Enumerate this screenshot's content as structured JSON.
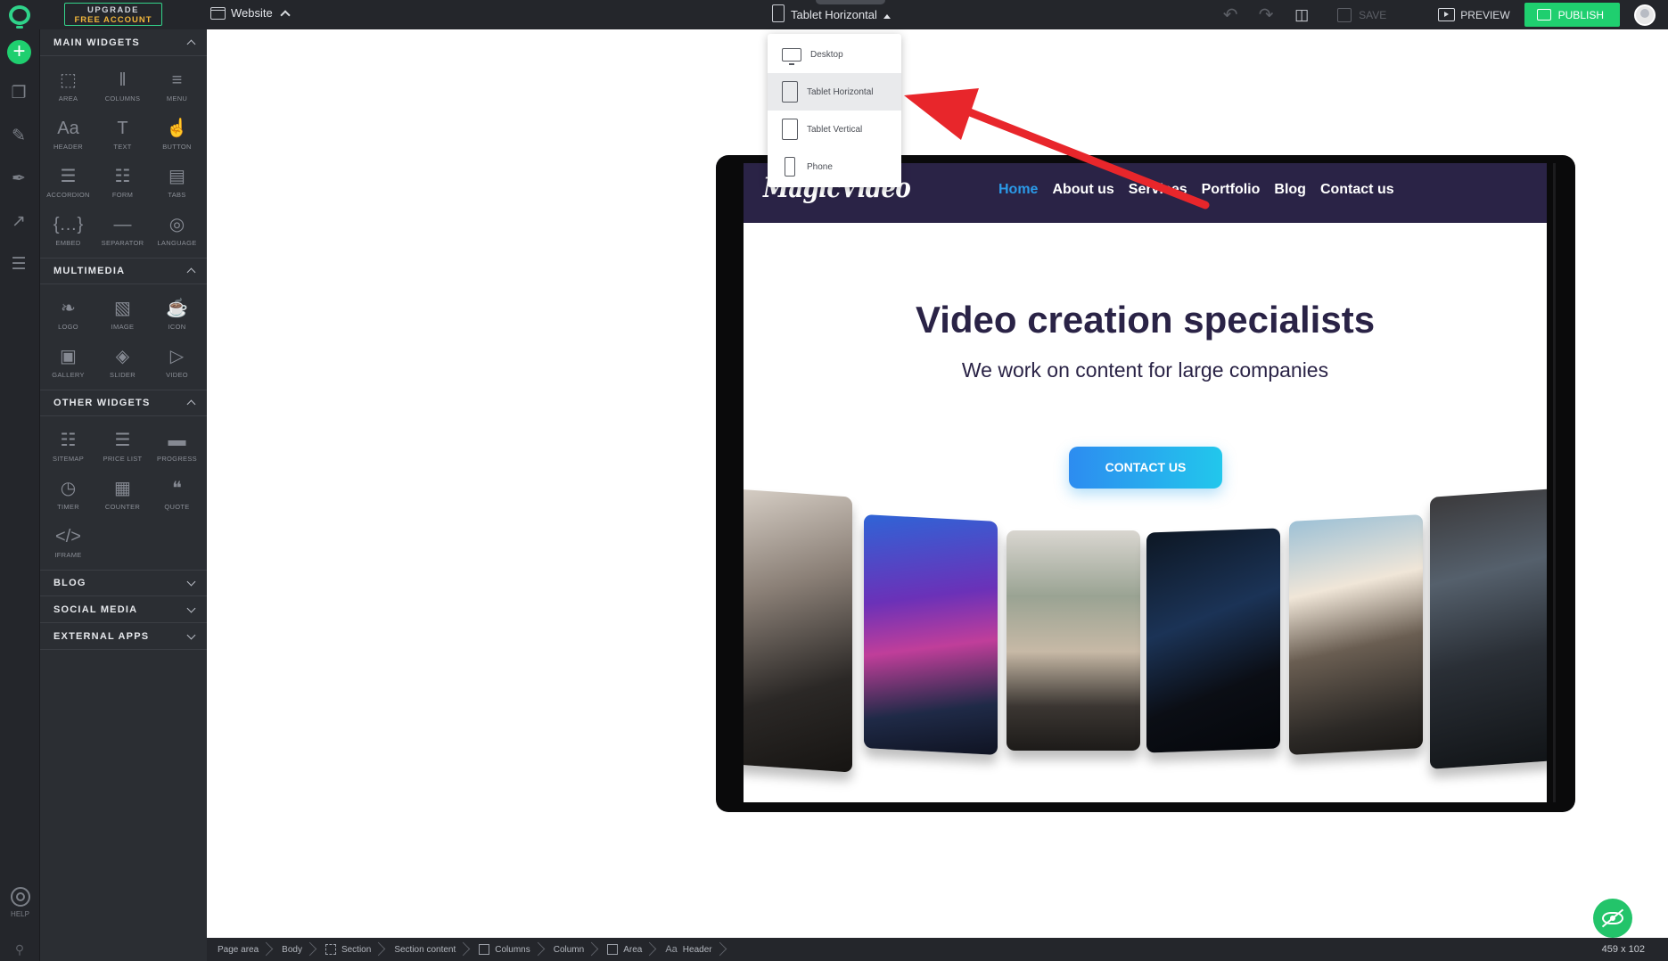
{
  "topbar": {
    "upgrade_line1": "UPGRADE",
    "upgrade_line2": "FREE ACCOUNT",
    "site_selector": "Website",
    "device_selector": "Tablet Horizontal",
    "save_label": "SAVE",
    "preview_label": "PREVIEW",
    "publish_label": "PUBLISH"
  },
  "rail": {
    "help_label": "HELP",
    "icons": [
      "add-icon",
      "pages-icon",
      "edit-icon",
      "design-brush-icon",
      "stats-icon",
      "layers-icon"
    ]
  },
  "panel": {
    "main_widgets": {
      "title": "MAIN WIDGETS",
      "items": [
        {
          "label": "AREA",
          "icon": "area-icon"
        },
        {
          "label": "COLUMNS",
          "icon": "columns-icon"
        },
        {
          "label": "MENU",
          "icon": "menu-icon"
        },
        {
          "label": "HEADER",
          "icon": "header-icon"
        },
        {
          "label": "TEXT",
          "icon": "text-icon"
        },
        {
          "label": "BUTTON",
          "icon": "button-icon"
        },
        {
          "label": "ACCORDION",
          "icon": "accordion-icon"
        },
        {
          "label": "FORM",
          "icon": "form-icon"
        },
        {
          "label": "TABS",
          "icon": "tabs-icon"
        },
        {
          "label": "EMBED",
          "icon": "embed-icon"
        },
        {
          "label": "SEPARATOR",
          "icon": "separator-icon"
        },
        {
          "label": "LANGUAGE",
          "icon": "language-icon"
        }
      ]
    },
    "multimedia": {
      "title": "MULTIMEDIA",
      "items": [
        {
          "label": "LOGO",
          "icon": "logo-icon"
        },
        {
          "label": "IMAGE",
          "icon": "image-icon"
        },
        {
          "label": "ICON",
          "icon": "icon-icon"
        },
        {
          "label": "GALLERY",
          "icon": "gallery-icon"
        },
        {
          "label": "SLIDER",
          "icon": "slider-icon"
        },
        {
          "label": "VIDEO",
          "icon": "video-icon"
        }
      ]
    },
    "other_widgets": {
      "title": "OTHER WIDGETS",
      "items": [
        {
          "label": "SITEMAP",
          "icon": "sitemap-icon"
        },
        {
          "label": "PRICE LIST",
          "icon": "price-list-icon"
        },
        {
          "label": "PROGRESS",
          "icon": "progress-icon"
        },
        {
          "label": "TIMER",
          "icon": "timer-icon"
        },
        {
          "label": "COUNTER",
          "icon": "counter-icon"
        },
        {
          "label": "QUOTE",
          "icon": "quote-icon"
        },
        {
          "label": "IFRAME",
          "icon": "iframe-icon"
        }
      ]
    },
    "collapsed_sections": [
      "BLOG",
      "SOCIAL MEDIA",
      "EXTERNAL APPS"
    ]
  },
  "device_menu": {
    "items": [
      {
        "label": "Desktop",
        "icon": "desktop-icon",
        "selected": false
      },
      {
        "label": "Tablet Horizontal",
        "icon": "tablet-horizontal-icon",
        "selected": true
      },
      {
        "label": "Tablet Vertical",
        "icon": "tablet-vertical-icon",
        "selected": false
      },
      {
        "label": "Phone",
        "icon": "phone-icon",
        "selected": false
      }
    ]
  },
  "preview_site": {
    "logo": "MagicVideo",
    "nav": [
      "Home",
      "About us",
      "Services",
      "Portfolio",
      "Blog",
      "Contact us"
    ],
    "active_nav": "Home",
    "hero_title": "Video creation specialists",
    "hero_subtitle": "We work on content for large companies",
    "cta_label": "CONTACT US",
    "colors": {
      "nav_bg": "#2a2346",
      "title": "#2a2346",
      "active_link": "#2b9ae8",
      "cta_from": "#2d8cf0",
      "cta_to": "#22c7ec"
    }
  },
  "bottombar": {
    "breadcrumb": [
      "Page area",
      "Body",
      "Section",
      "Section content",
      "Columns",
      "Column",
      "Area",
      "Header"
    ],
    "dimensions": "459 x 102"
  },
  "colors": {
    "brand_green": "#1fcf6f",
    "annotation_arrow": "#e8262b",
    "dark_ui": "#24262b"
  }
}
